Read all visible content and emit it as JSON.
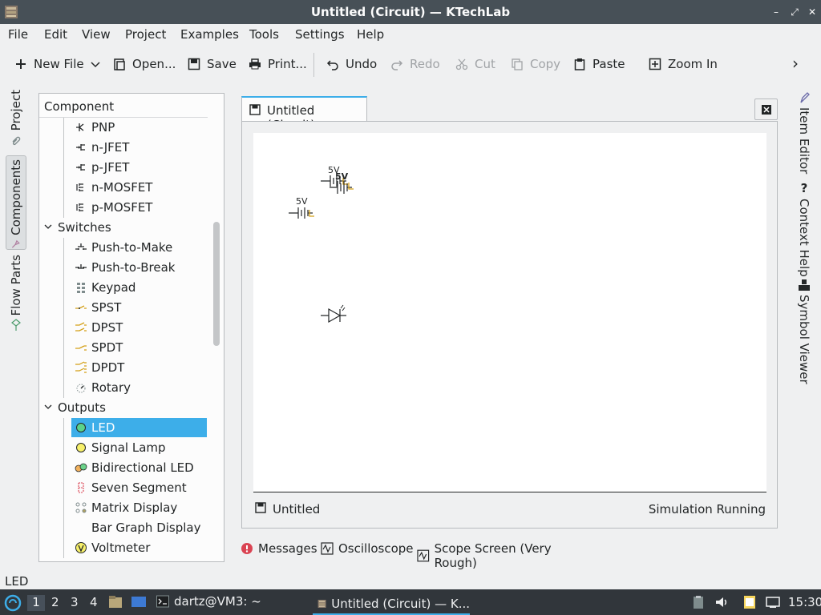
{
  "window": {
    "title": "Untitled (Circuit) — KTechLab",
    "buttons": [
      "–",
      "⤢",
      "✕"
    ]
  },
  "menu": [
    "File",
    "Edit",
    "View",
    "Project",
    "Examples",
    "Tools",
    "Settings",
    "Help"
  ],
  "toolbar": {
    "new_file": "New File",
    "open": "Open...",
    "save": "Save",
    "print": "Print...",
    "undo": "Undo",
    "redo": "Redo",
    "cut": "Cut",
    "copy": "Copy",
    "paste": "Paste",
    "zoom_in": "Zoom In",
    "more": "›"
  },
  "left_tabs": [
    "Project",
    "Components",
    "Flow Parts"
  ],
  "component_panel": {
    "header": "Component",
    "tree": [
      {
        "type": "item",
        "label": "PNP",
        "icon": "pnp-icon"
      },
      {
        "type": "item",
        "label": "n-JFET",
        "icon": "n-jfet-icon"
      },
      {
        "type": "item",
        "label": "p-JFET",
        "icon": "p-jfet-icon"
      },
      {
        "type": "item",
        "label": "n-MOSFET",
        "icon": "n-mosfet-icon"
      },
      {
        "type": "item",
        "label": "p-MOSFET",
        "icon": "p-mosfet-icon"
      },
      {
        "type": "category",
        "label": "Switches"
      },
      {
        "type": "item",
        "label": "Push-to-Make",
        "icon": "push-to-make-icon"
      },
      {
        "type": "item",
        "label": "Push-to-Break",
        "icon": "push-to-break-icon"
      },
      {
        "type": "item",
        "label": "Keypad",
        "icon": "keypad-icon"
      },
      {
        "type": "item",
        "label": "SPST",
        "icon": "spst-icon"
      },
      {
        "type": "item",
        "label": "DPST",
        "icon": "dpst-icon"
      },
      {
        "type": "item",
        "label": "SPDT",
        "icon": "spdt-icon"
      },
      {
        "type": "item",
        "label": "DPDT",
        "icon": "dpdt-icon"
      },
      {
        "type": "item",
        "label": "Rotary",
        "icon": "rotary-icon"
      },
      {
        "type": "category",
        "label": "Outputs"
      },
      {
        "type": "item",
        "label": "LED",
        "icon": "led-icon",
        "selected": true
      },
      {
        "type": "item",
        "label": "Signal Lamp",
        "icon": "signal-lamp-icon"
      },
      {
        "type": "item",
        "label": "Bidirectional LED",
        "icon": "bidirectional-led-icon"
      },
      {
        "type": "item",
        "label": "Seven Segment",
        "icon": "seven-segment-icon"
      },
      {
        "type": "item",
        "label": "Matrix Display",
        "icon": "matrix-display-icon"
      },
      {
        "type": "item",
        "label": "Bar Graph Display",
        "icon": ""
      },
      {
        "type": "item",
        "label": "Voltmeter",
        "icon": "voltmeter-icon"
      }
    ]
  },
  "document": {
    "tab_label": "Untitled (Circuit)",
    "canvas_labels": [
      "5V",
      "5V",
      "5V"
    ],
    "status_name": "Untitled",
    "status_sim": "Simulation Running"
  },
  "bottom_tabs": [
    "Messages",
    "Oscilloscope",
    "Scope Screen (Very Rough)"
  ],
  "right_tabs": [
    "Item Editor",
    "Context Help",
    "Symbol Viewer"
  ],
  "statusbar": {
    "message": "LED"
  },
  "taskbar": {
    "workspaces": [
      "1",
      "2",
      "3",
      "4"
    ],
    "tasks": [
      "dartz@VM3: ~",
      "Untitled (Circuit) — K..."
    ],
    "clock": "15:30"
  },
  "colors": {
    "accent": "#3daee9",
    "titlebar": "#475057",
    "taskbar": "#31363b",
    "battery_terminal": "#d4a017"
  }
}
